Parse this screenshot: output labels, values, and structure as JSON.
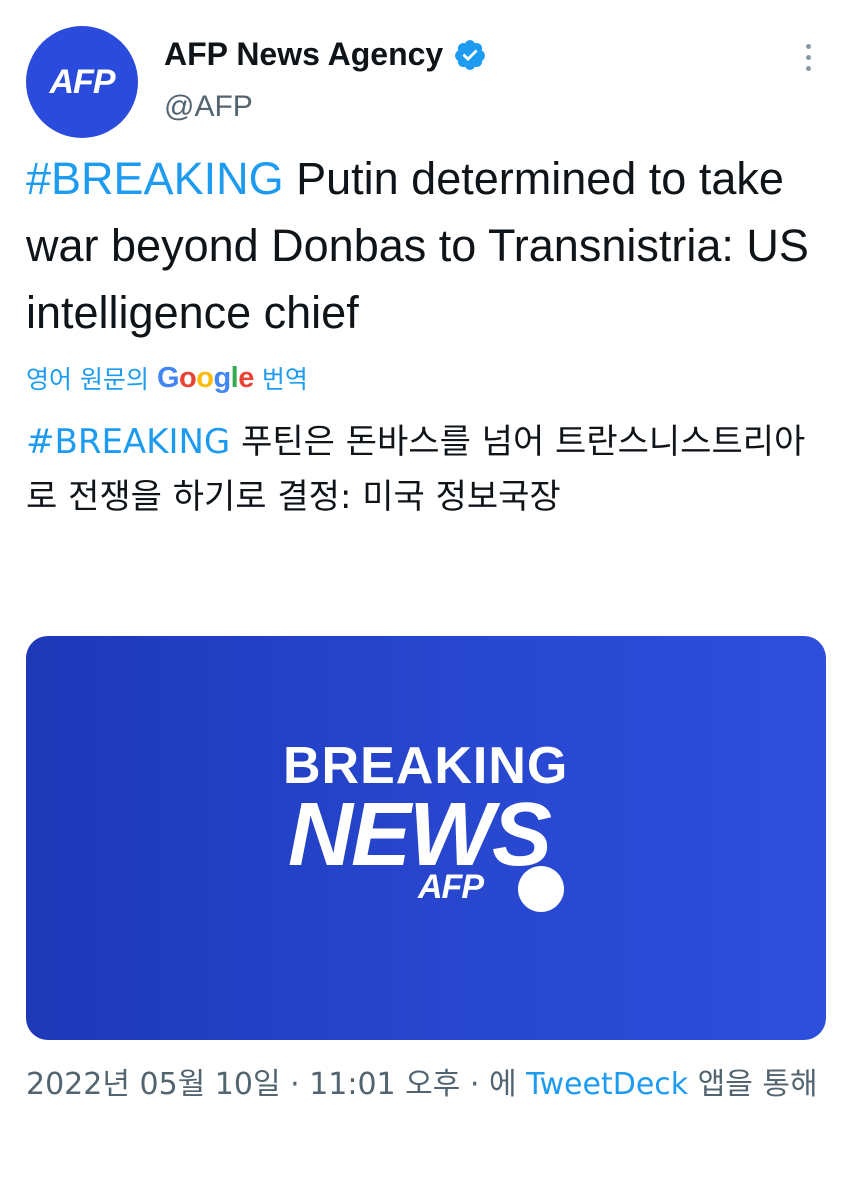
{
  "author": {
    "avatar_text": "AFP",
    "name": "AFP News Agency",
    "handle": "@AFP"
  },
  "tweet": {
    "hashtag": "#BREAKING",
    "text": " Putin determined to take war beyond Donbas to Transnistria: US intelligence chief"
  },
  "translation": {
    "prefix": "영어 원문의",
    "google": "Google",
    "suffix": "번역",
    "hashtag": "#BREAKING",
    "text": " 푸틴은 돈바스를 넘어 트란스니스트리아로 전쟁을 하기로 결정: 미국 정보국장"
  },
  "card": {
    "line1": "BREAKING",
    "line2": "NEWS",
    "line3": "AFP"
  },
  "meta": {
    "date": "2022년 05월 10일",
    "sep1": " · ",
    "time": "11:01 오후",
    "sep2": " · ",
    "via_prefix": "에 ",
    "source": "TweetDeck",
    "via_suffix": " 앱을 통해"
  },
  "colors": {
    "link": "#1d9bf0",
    "brand": "#2a4bdc",
    "google_blue": "#4285f4",
    "google_red": "#ea4335",
    "google_yellow": "#fbbc05",
    "google_green": "#34a853"
  },
  "icons": {
    "verified": "verified-badge-icon",
    "more": "more-vertical-icon"
  }
}
